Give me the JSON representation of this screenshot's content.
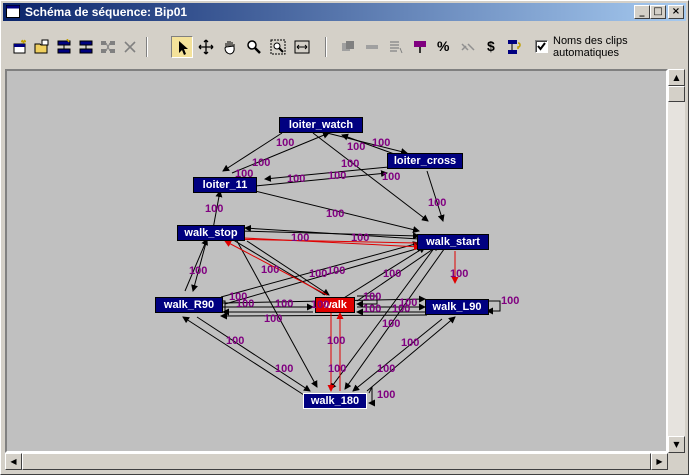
{
  "window": {
    "title": "Schéma de séquence: Bip01"
  },
  "window_buttons": {
    "minimize": "_",
    "maximize": "□",
    "close": "×"
  },
  "toolbar": {
    "checkbox_label": "Noms des clips automatiques",
    "checkbox_checked": true,
    "percent_glyph": "%",
    "dollar_glyph": "$",
    "icons": [
      "new-clip-icon",
      "open-clip-icon",
      "insert-transition-icon",
      "remove-transition-icon",
      "grid-icon",
      "delete-icon",
      "select-arrow-icon",
      "move-icon",
      "pan-hand-icon",
      "zoom-icon",
      "zoom-region-icon",
      "fit-icon",
      "properties-icon",
      "minus-icon",
      "list-icon",
      "flag-icon",
      "percent-icon",
      "shuffle-icon",
      "dollar-icon",
      "script-icon"
    ]
  },
  "graph": {
    "colors": {
      "node": "#000080",
      "active_node": "#e00000",
      "edge": "#000000",
      "active_edge": "#e00000",
      "weight": "#800080"
    },
    "nodes": [
      {
        "id": "loiter_watch",
        "label": "loiter_watch"
      },
      {
        "id": "loiter_cross",
        "label": "loiter_cross"
      },
      {
        "id": "loiter_11",
        "label": "loiter_11"
      },
      {
        "id": "walk_stop",
        "label": "walk_stop"
      },
      {
        "id": "walk_start",
        "label": "walk_start"
      },
      {
        "id": "walk_R90",
        "label": "walk_R90"
      },
      {
        "id": "walk",
        "label": "walk",
        "active": true
      },
      {
        "id": "walk_L90",
        "label": "walk_L90"
      },
      {
        "id": "walk_180",
        "label": "walk_180",
        "outlined": true
      }
    ],
    "weights": [
      "100",
      "100",
      "100",
      "100",
      "100",
      "100",
      "100",
      "100",
      "100",
      "100",
      "100",
      "100",
      "100",
      "100",
      "100",
      "100",
      "100",
      "100",
      "100",
      "100",
      "100",
      "100",
      "100",
      "100",
      "100",
      "100",
      "100",
      "100",
      "100",
      "100",
      "100",
      "100",
      "100",
      "100"
    ]
  }
}
